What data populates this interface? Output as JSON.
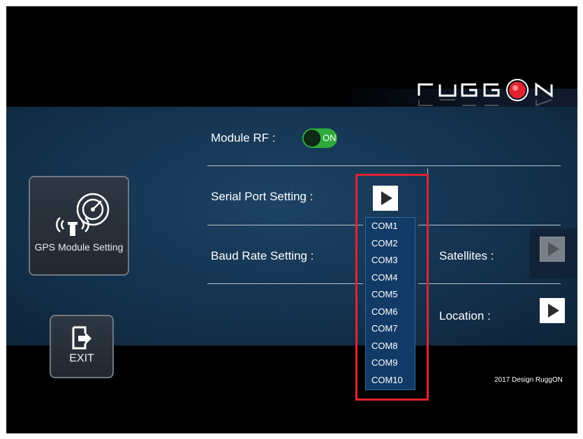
{
  "brand": {
    "logo_text": "RUGGON",
    "accent": "#e2232f"
  },
  "sidebar": {
    "gps_button_label": "GPS Module Setting",
    "gps_icon": "gps-antenna-radar-icon",
    "exit_button_label": "EXIT",
    "exit_icon": "exit-door-icon"
  },
  "settings": {
    "module_rf_label": "Module RF :",
    "module_rf_state": "ON",
    "serial_port_label": "Serial Port Setting :",
    "baud_rate_label": "Baud Rate Setting :",
    "satellites_label": "Satellites :",
    "location_label": "Location :"
  },
  "serial_dropdown": {
    "options": [
      "COM1",
      "COM2",
      "COM3",
      "COM4",
      "COM5",
      "COM6",
      "COM7",
      "COM8",
      "COM9",
      "COM10"
    ]
  },
  "footer": {
    "copyright": "2017 Design RuggON"
  },
  "colors": {
    "panel": "#153553",
    "toggle_on": "#2faa3b",
    "highlight_box": "#e2232f"
  }
}
